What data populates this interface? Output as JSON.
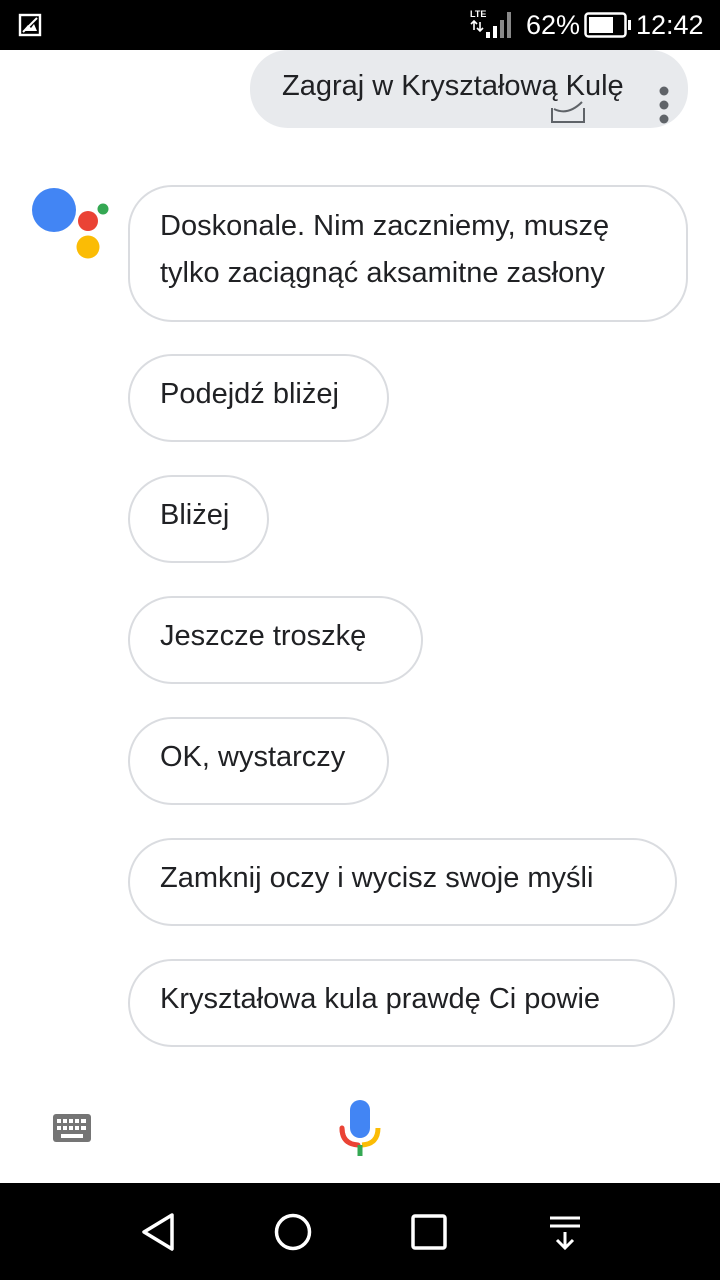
{
  "status_bar": {
    "network": "LTE",
    "battery_percent": "62%",
    "time": "12:42"
  },
  "query": {
    "text": "Zagraj w Kryształową Kulę"
  },
  "responses": [
    "Doskonale. Nim zaczniemy, muszę tylko zaciągnąć aksamitne zasłony",
    "Podejdź bliżej",
    "Bliżej",
    "Jeszcze troszkę",
    "OK, wystarczy",
    "Zamknij oczy i wycisz swoje myśli",
    "Kryształowa kula prawdę Ci powie"
  ],
  "colors": {
    "google_blue": "#4285f4",
    "google_red": "#ea4335",
    "google_yellow": "#fbbc05",
    "google_green": "#34a853"
  },
  "icons": {
    "status": [
      "gallery-icon",
      "lte-signal-icon",
      "battery-icon"
    ],
    "query": [
      "edit-icon",
      "more-vert-icon"
    ],
    "input": [
      "keyboard-icon",
      "mic-icon"
    ],
    "nav": [
      "back-icon",
      "home-icon",
      "recent-apps-icon",
      "notification-pull-icon"
    ]
  }
}
